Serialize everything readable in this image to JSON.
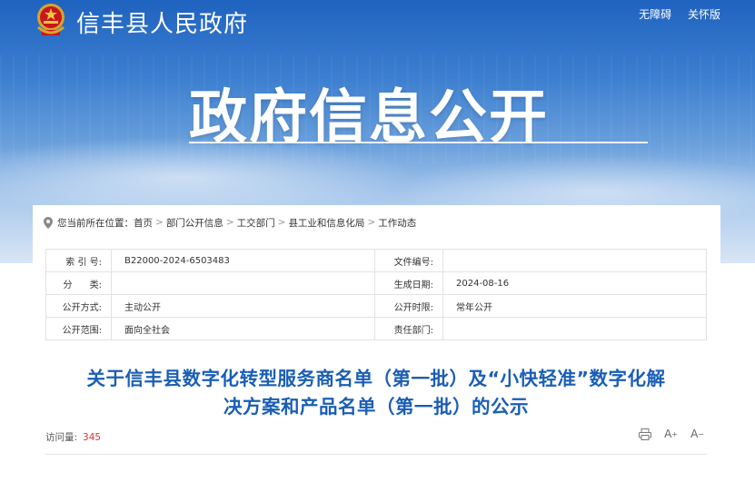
{
  "header": {
    "site_name": "信丰县人民政府",
    "links": [
      "无障碍",
      "关怀版"
    ],
    "banner_title": "政府信息公开"
  },
  "breadcrumb": {
    "prefix": "您当前所在位置：",
    "items": [
      "首页",
      "部门公开信息",
      "工交部门",
      "县工业和信息化局",
      "工作动态"
    ]
  },
  "meta": {
    "rows": [
      {
        "k1": "索 引 号:",
        "v1": "B22000-2024-6503483",
        "k2": "文件编号:",
        "v2": ""
      },
      {
        "k1": "分      类:",
        "v1": "",
        "k2": "生成日期:",
        "v2": "2024-08-16"
      },
      {
        "k1": "公开方式:",
        "v1": "主动公开",
        "k2": "公开时限:",
        "v2": "常年公开"
      },
      {
        "k1": "公开范围:",
        "v1": "面向全社会",
        "k2": "责任部门:",
        "v2": ""
      }
    ]
  },
  "article": {
    "title_line1": "关于信丰县数字化转型服务商名单（第一批）及“小快轻准”数字化解",
    "title_line2": "决方案和产品名单（第一批）的公示",
    "views_label": "访问量:",
    "views_count": "345"
  },
  "tools": {
    "font_increase": "A",
    "font_decrease": "A"
  },
  "colors": {
    "accent": "#1a5eb5",
    "count": "#dd3333"
  }
}
